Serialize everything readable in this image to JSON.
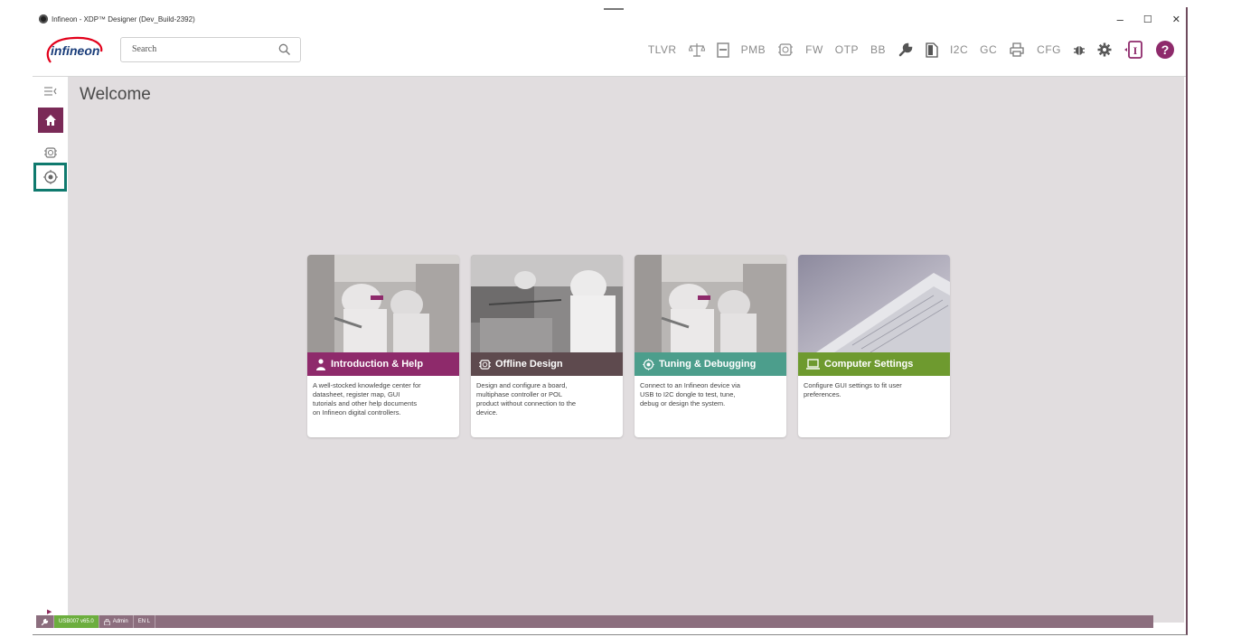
{
  "window": {
    "title": "Infineon - XDP™ Designer (Dev_Build-2392)",
    "controls": [
      "–",
      "☐",
      "✕"
    ]
  },
  "logo": {
    "text": "infineon"
  },
  "search": {
    "placeholder": "Search"
  },
  "toolbar": {
    "items": [
      {
        "type": "text",
        "label": "TLVR",
        "icon": "tlvr-text"
      },
      {
        "type": "icon",
        "icon": "balance-scale-icon"
      },
      {
        "type": "icon",
        "icon": "register-list-icon"
      },
      {
        "type": "text",
        "label": "PMB",
        "icon": "pmb-text"
      },
      {
        "type": "icon",
        "icon": "chip-icon"
      },
      {
        "type": "text",
        "label": "FW",
        "icon": "fw-text"
      },
      {
        "type": "text",
        "label": "OTP",
        "icon": "otp-text"
      },
      {
        "type": "text",
        "label": "BB",
        "icon": "bb-text"
      },
      {
        "type": "icon",
        "icon": "wrench-icon"
      },
      {
        "type": "icon",
        "icon": "document-icon"
      },
      {
        "type": "text",
        "label": "I2C",
        "icon": "i2c-text"
      },
      {
        "type": "text",
        "label": "GC",
        "icon": "gc-text"
      },
      {
        "type": "icon",
        "icon": "printer-icon"
      },
      {
        "type": "text",
        "label": "CFG",
        "icon": "cfg-text"
      },
      {
        "type": "icon",
        "icon": "bug-icon"
      },
      {
        "type": "icon",
        "icon": "gear-icon"
      },
      {
        "type": "icon",
        "icon": "info-panel-icon"
      },
      {
        "type": "icon",
        "icon": "help-icon"
      }
    ]
  },
  "sidebar": {
    "items": [
      {
        "icon": "collapse-menu-icon"
      },
      {
        "icon": "home-icon",
        "active": true
      },
      {
        "icon": "offline-design-icon"
      },
      {
        "icon": "tuning-target-icon",
        "highlighted": true
      }
    ]
  },
  "main": {
    "title": "Welcome",
    "cards": [
      {
        "title": "Introduction & Help",
        "icon": "person-help-icon",
        "color": "#8e2a6b",
        "desc_lines": [
          "A well-stocked knowledge center for",
          "datasheet, register map, GUI",
          "tutorials and other help documents",
          "on Infineon digital controllers."
        ]
      },
      {
        "title": "Offline Design",
        "icon": "chip-icon",
        "color": "#5e4a4e",
        "desc_lines": [
          "Design and configure a board,",
          "multiphase controller or POL",
          "product without connection to the",
          "device."
        ]
      },
      {
        "title": "Tuning & Debugging",
        "icon": "target-icon",
        "color": "#4c9e8c",
        "desc_lines": [
          "Connect to an Infineon device via",
          "USB to I2C dongle to test, tune,",
          "debug or design the system."
        ]
      },
      {
        "title": "Computer Settings",
        "icon": "laptop-icon",
        "color": "#6e9a2f",
        "desc_lines": [
          "Configure GUI settings to fit user",
          "preferences."
        ]
      }
    ]
  },
  "statusbar": {
    "usb": "USB007 v65.0",
    "user": "Admin",
    "lang": "EN L"
  },
  "colors": {
    "accent": "#7a2a57",
    "highlight": "#0f7a6e",
    "statusbar": "#8c6e7e",
    "usb_badge": "#6cae3e"
  }
}
